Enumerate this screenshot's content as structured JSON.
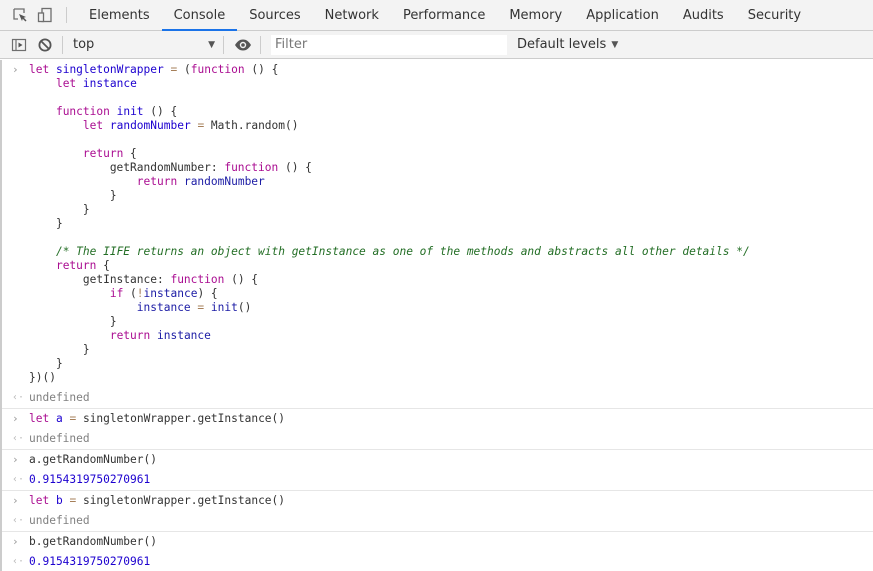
{
  "tabbar": {
    "icons": [
      "inspect-element-icon",
      "device-toolbar-icon"
    ],
    "tabs": [
      {
        "label": "Elements",
        "active": false
      },
      {
        "label": "Console",
        "active": true
      },
      {
        "label": "Sources",
        "active": false
      },
      {
        "label": "Network",
        "active": false
      },
      {
        "label": "Performance",
        "active": false
      },
      {
        "label": "Memory",
        "active": false
      },
      {
        "label": "Application",
        "active": false
      },
      {
        "label": "Audits",
        "active": false
      },
      {
        "label": "Security",
        "active": false
      }
    ],
    "accent": "#1a73e8"
  },
  "toolbar": {
    "context": "top",
    "filter_placeholder": "Filter",
    "filter_value": "",
    "levels_label": "Default levels"
  },
  "console": {
    "entries": [
      {
        "type": "input",
        "lines": [
          [
            [
              "kw",
              "let"
            ],
            [
              "",
              " "
            ],
            [
              "def",
              "singletonWrapper"
            ],
            [
              "",
              " "
            ],
            [
              "op",
              "="
            ],
            [
              "",
              " ("
            ],
            [
              "kw",
              "function"
            ],
            [
              "",
              " () {"
            ]
          ],
          [
            [
              "",
              "    "
            ],
            [
              "kw",
              "let"
            ],
            [
              "",
              " "
            ],
            [
              "def",
              "instance"
            ]
          ],
          [
            [
              "",
              ""
            ]
          ],
          [
            [
              "",
              "    "
            ],
            [
              "kw",
              "function"
            ],
            [
              "",
              " "
            ],
            [
              "def",
              "init"
            ],
            [
              "",
              " () {"
            ]
          ],
          [
            [
              "",
              "        "
            ],
            [
              "kw",
              "let"
            ],
            [
              "",
              " "
            ],
            [
              "def",
              "randomNumber"
            ],
            [
              "",
              " "
            ],
            [
              "op",
              "="
            ],
            [
              "",
              " Math.random()"
            ]
          ],
          [
            [
              "",
              ""
            ]
          ],
          [
            [
              "",
              "        "
            ],
            [
              "kw",
              "return"
            ],
            [
              "",
              " {"
            ]
          ],
          [
            [
              "",
              "            getRandomNumber: "
            ],
            [
              "kw",
              "function"
            ],
            [
              "",
              " () {"
            ]
          ],
          [
            [
              "",
              "                "
            ],
            [
              "kw",
              "return"
            ],
            [
              "",
              " "
            ],
            [
              "var",
              "randomNumber"
            ]
          ],
          [
            [
              "",
              "            }"
            ]
          ],
          [
            [
              "",
              "        }"
            ]
          ],
          [
            [
              "",
              "    }"
            ]
          ],
          [
            [
              "",
              ""
            ]
          ],
          [
            [
              "",
              "    "
            ],
            [
              "cmt",
              "/* The IIFE returns an object with getInstance as one of the methods and abstracts all other details */"
            ]
          ],
          [
            [
              "",
              "    "
            ],
            [
              "kw",
              "return"
            ],
            [
              "",
              " {"
            ]
          ],
          [
            [
              "",
              "        getInstance: "
            ],
            [
              "kw",
              "function"
            ],
            [
              "",
              " () {"
            ]
          ],
          [
            [
              "",
              "            "
            ],
            [
              "kw",
              "if"
            ],
            [
              "",
              " ("
            ],
            [
              "op",
              "!"
            ],
            [
              "var",
              "instance"
            ],
            [
              "",
              ") {"
            ]
          ],
          [
            [
              "",
              "                "
            ],
            [
              "var",
              "instance"
            ],
            [
              "",
              " "
            ],
            [
              "op",
              "="
            ],
            [
              "",
              " "
            ],
            [
              "var",
              "init"
            ],
            [
              "",
              "()"
            ]
          ],
          [
            [
              "",
              "            }"
            ]
          ],
          [
            [
              "",
              "            "
            ],
            [
              "kw",
              "return"
            ],
            [
              "",
              " "
            ],
            [
              "var",
              "instance"
            ]
          ],
          [
            [
              "",
              "        }"
            ]
          ],
          [
            [
              "",
              "    }"
            ]
          ],
          [
            [
              "",
              "})()"
            ]
          ]
        ]
      },
      {
        "type": "result",
        "kind": "undef",
        "text": "undefined"
      },
      {
        "type": "input",
        "lines": [
          [
            [
              "kw",
              "let"
            ],
            [
              "",
              " "
            ],
            [
              "def",
              "a"
            ],
            [
              "",
              " "
            ],
            [
              "op",
              "="
            ],
            [
              "",
              " singletonWrapper.getInstance()"
            ]
          ]
        ]
      },
      {
        "type": "result",
        "kind": "undef",
        "text": "undefined"
      },
      {
        "type": "input",
        "lines": [
          [
            [
              "",
              "a.getRandomNumber()"
            ]
          ]
        ]
      },
      {
        "type": "result",
        "kind": "num",
        "text": "0.9154319750270961"
      },
      {
        "type": "input",
        "lines": [
          [
            [
              "kw",
              "let"
            ],
            [
              "",
              " "
            ],
            [
              "def",
              "b"
            ],
            [
              "",
              " "
            ],
            [
              "op",
              "="
            ],
            [
              "",
              " singletonWrapper.getInstance()"
            ]
          ]
        ]
      },
      {
        "type": "result",
        "kind": "undef",
        "text": "undefined"
      },
      {
        "type": "input",
        "lines": [
          [
            [
              "",
              "b.getRandomNumber()"
            ]
          ]
        ]
      },
      {
        "type": "result",
        "kind": "num",
        "text": "0.9154319750270961"
      }
    ]
  }
}
